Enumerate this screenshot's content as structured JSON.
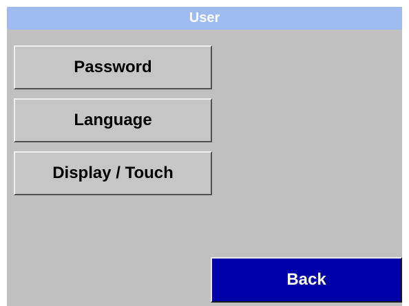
{
  "title_bar": {
    "title": "User"
  },
  "menu": {
    "items": [
      {
        "label": "Password"
      },
      {
        "label": "Language"
      },
      {
        "label": "Display / Touch"
      }
    ]
  },
  "footer": {
    "back_label": "Back"
  },
  "colors": {
    "title_bar_bg": "#9ebcf0",
    "screen_bg": "#c0c0c0",
    "button_bg": "#c6c6c6",
    "back_button_bg": "#0000a8"
  }
}
